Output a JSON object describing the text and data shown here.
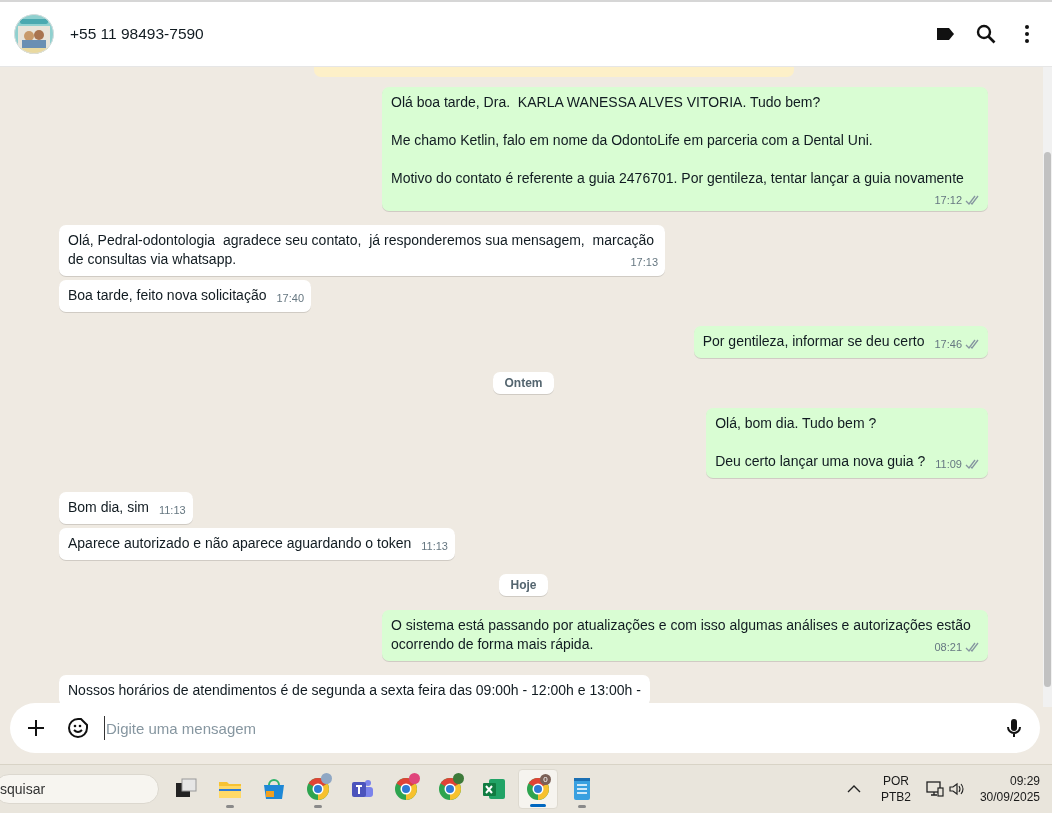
{
  "header": {
    "contact": "+55 11 98493-7590"
  },
  "messages": [
    {
      "kind": "notice"
    },
    {
      "kind": "out",
      "paragraphs": [
        "Olá boa tarde, Dra.  KARLA WANESSA ALVES VITORIA. Tudo bem?",
        "Me chamo Ketlin, falo em nome da OdontoLife em parceria com a Dental Uni.",
        "Motivo do contato é referente a guia 2476701. Por gentileza, tentar lançar a guia novamente"
      ],
      "time": "17:12",
      "read": false
    },
    {
      "kind": "in",
      "paragraphs": [
        "Olá, Pedral-odontologia  agradece seu contato,  já responderemos sua mensagem,  marcação de consultas via whatsapp."
      ],
      "time": "17:13"
    },
    {
      "kind": "in",
      "paragraphs": [
        "Boa tarde, feito nova solicitação"
      ],
      "time": "17:40"
    },
    {
      "kind": "out",
      "paragraphs": [
        "Por gentileza, informar se deu certo"
      ],
      "time": "17:46",
      "read": false
    },
    {
      "kind": "date",
      "label": "Ontem"
    },
    {
      "kind": "out",
      "paragraphs": [
        "Olá, bom dia. Tudo bem ?",
        "Deu certo lançar uma nova guia ?"
      ],
      "time": "11:09",
      "read": false
    },
    {
      "kind": "in",
      "paragraphs": [
        "Bom dia, sim"
      ],
      "time": "11:13"
    },
    {
      "kind": "in",
      "paragraphs": [
        "Aparece autorizado e não aparece aguardando o token"
      ],
      "time": "11:13"
    },
    {
      "kind": "date",
      "label": "Hoje"
    },
    {
      "kind": "out",
      "paragraphs": [
        "O sistema está passando por atualizações e com isso algumas análises e autorizações estão ocorrendo de forma mais rápida."
      ],
      "time": "08:21",
      "read": false
    },
    {
      "kind": "in",
      "paragraphs": [
        "Nossos horários de atendimentos é de segunda a sexta feira das 09:00h - 12:00h e 13:00h -"
      ]
    }
  ],
  "composer": {
    "placeholder": "Digite uma mensagem"
  },
  "taskbar": {
    "search": "squisar",
    "apps": [
      {
        "kind": "taskview",
        "open": false,
        "active": false
      },
      {
        "kind": "explorer",
        "open": true,
        "active": false
      },
      {
        "kind": "store",
        "open": false,
        "active": false
      },
      {
        "kind": "chrome",
        "open": true,
        "active": false,
        "color": "#8fa7c4"
      },
      {
        "kind": "teams",
        "open": false,
        "active": false
      },
      {
        "kind": "chrome",
        "open": false,
        "active": false,
        "color": "#e0457b"
      },
      {
        "kind": "chrome",
        "open": false,
        "active": false,
        "color": "#3d7a3a"
      },
      {
        "kind": "excel",
        "open": false,
        "active": false
      },
      {
        "kind": "chrome",
        "open": true,
        "active": true,
        "color": "#7b6157",
        "badge": "0"
      },
      {
        "kind": "notepad",
        "open": true,
        "active": false
      }
    ],
    "language": "POR",
    "layout": "PTB2",
    "time": "09:29",
    "date": "30/09/2025"
  }
}
